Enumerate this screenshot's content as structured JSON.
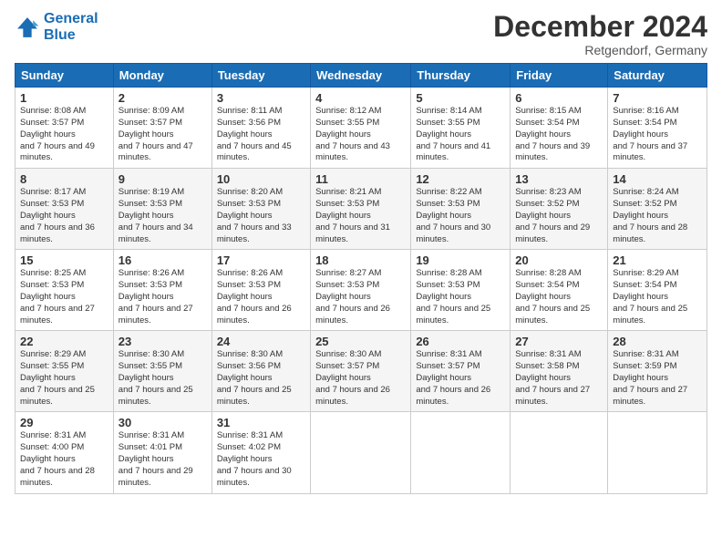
{
  "logo": {
    "line1": "General",
    "line2": "Blue"
  },
  "title": "December 2024",
  "subtitle": "Retgendorf, Germany",
  "days_header": [
    "Sunday",
    "Monday",
    "Tuesday",
    "Wednesday",
    "Thursday",
    "Friday",
    "Saturday"
  ],
  "weeks": [
    [
      {
        "day": "1",
        "sunrise": "8:08 AM",
        "sunset": "3:57 PM",
        "daylight": "7 hours and 49 minutes."
      },
      {
        "day": "2",
        "sunrise": "8:09 AM",
        "sunset": "3:57 PM",
        "daylight": "7 hours and 47 minutes."
      },
      {
        "day": "3",
        "sunrise": "8:11 AM",
        "sunset": "3:56 PM",
        "daylight": "7 hours and 45 minutes."
      },
      {
        "day": "4",
        "sunrise": "8:12 AM",
        "sunset": "3:55 PM",
        "daylight": "7 hours and 43 minutes."
      },
      {
        "day": "5",
        "sunrise": "8:14 AM",
        "sunset": "3:55 PM",
        "daylight": "7 hours and 41 minutes."
      },
      {
        "day": "6",
        "sunrise": "8:15 AM",
        "sunset": "3:54 PM",
        "daylight": "7 hours and 39 minutes."
      },
      {
        "day": "7",
        "sunrise": "8:16 AM",
        "sunset": "3:54 PM",
        "daylight": "7 hours and 37 minutes."
      }
    ],
    [
      {
        "day": "8",
        "sunrise": "8:17 AM",
        "sunset": "3:53 PM",
        "daylight": "7 hours and 36 minutes."
      },
      {
        "day": "9",
        "sunrise": "8:19 AM",
        "sunset": "3:53 PM",
        "daylight": "7 hours and 34 minutes."
      },
      {
        "day": "10",
        "sunrise": "8:20 AM",
        "sunset": "3:53 PM",
        "daylight": "7 hours and 33 minutes."
      },
      {
        "day": "11",
        "sunrise": "8:21 AM",
        "sunset": "3:53 PM",
        "daylight": "7 hours and 31 minutes."
      },
      {
        "day": "12",
        "sunrise": "8:22 AM",
        "sunset": "3:53 PM",
        "daylight": "7 hours and 30 minutes."
      },
      {
        "day": "13",
        "sunrise": "8:23 AM",
        "sunset": "3:52 PM",
        "daylight": "7 hours and 29 minutes."
      },
      {
        "day": "14",
        "sunrise": "8:24 AM",
        "sunset": "3:52 PM",
        "daylight": "7 hours and 28 minutes."
      }
    ],
    [
      {
        "day": "15",
        "sunrise": "8:25 AM",
        "sunset": "3:53 PM",
        "daylight": "7 hours and 27 minutes."
      },
      {
        "day": "16",
        "sunrise": "8:26 AM",
        "sunset": "3:53 PM",
        "daylight": "7 hours and 27 minutes."
      },
      {
        "day": "17",
        "sunrise": "8:26 AM",
        "sunset": "3:53 PM",
        "daylight": "7 hours and 26 minutes."
      },
      {
        "day": "18",
        "sunrise": "8:27 AM",
        "sunset": "3:53 PM",
        "daylight": "7 hours and 26 minutes."
      },
      {
        "day": "19",
        "sunrise": "8:28 AM",
        "sunset": "3:53 PM",
        "daylight": "7 hours and 25 minutes."
      },
      {
        "day": "20",
        "sunrise": "8:28 AM",
        "sunset": "3:54 PM",
        "daylight": "7 hours and 25 minutes."
      },
      {
        "day": "21",
        "sunrise": "8:29 AM",
        "sunset": "3:54 PM",
        "daylight": "7 hours and 25 minutes."
      }
    ],
    [
      {
        "day": "22",
        "sunrise": "8:29 AM",
        "sunset": "3:55 PM",
        "daylight": "7 hours and 25 minutes."
      },
      {
        "day": "23",
        "sunrise": "8:30 AM",
        "sunset": "3:55 PM",
        "daylight": "7 hours and 25 minutes."
      },
      {
        "day": "24",
        "sunrise": "8:30 AM",
        "sunset": "3:56 PM",
        "daylight": "7 hours and 25 minutes."
      },
      {
        "day": "25",
        "sunrise": "8:30 AM",
        "sunset": "3:57 PM",
        "daylight": "7 hours and 26 minutes."
      },
      {
        "day": "26",
        "sunrise": "8:31 AM",
        "sunset": "3:57 PM",
        "daylight": "7 hours and 26 minutes."
      },
      {
        "day": "27",
        "sunrise": "8:31 AM",
        "sunset": "3:58 PM",
        "daylight": "7 hours and 27 minutes."
      },
      {
        "day": "28",
        "sunrise": "8:31 AM",
        "sunset": "3:59 PM",
        "daylight": "7 hours and 27 minutes."
      }
    ],
    [
      {
        "day": "29",
        "sunrise": "8:31 AM",
        "sunset": "4:00 PM",
        "daylight": "7 hours and 28 minutes."
      },
      {
        "day": "30",
        "sunrise": "8:31 AM",
        "sunset": "4:01 PM",
        "daylight": "7 hours and 29 minutes."
      },
      {
        "day": "31",
        "sunrise": "8:31 AM",
        "sunset": "4:02 PM",
        "daylight": "7 hours and 30 minutes."
      },
      null,
      null,
      null,
      null
    ]
  ]
}
